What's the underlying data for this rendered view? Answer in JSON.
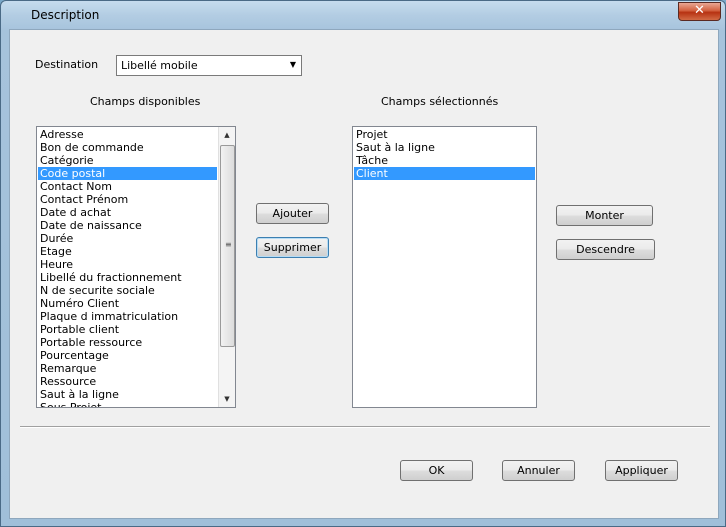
{
  "window": {
    "title": "Description",
    "close_glyph": "✕"
  },
  "destination": {
    "label": "Destination",
    "value": "Libellé mobile"
  },
  "available": {
    "header": "Champs disponibles",
    "items": [
      {
        "label": "Adresse",
        "selected": false
      },
      {
        "label": "Bon de commande",
        "selected": false
      },
      {
        "label": "Catégorie",
        "selected": false
      },
      {
        "label": "Code postal",
        "selected": true
      },
      {
        "label": "Contact Nom",
        "selected": false
      },
      {
        "label": "Contact Prénom",
        "selected": false
      },
      {
        "label": "Date d achat",
        "selected": false
      },
      {
        "label": "Date de naissance",
        "selected": false
      },
      {
        "label": "Durée",
        "selected": false
      },
      {
        "label": "Etage",
        "selected": false
      },
      {
        "label": "Heure",
        "selected": false
      },
      {
        "label": "Libellé du fractionnement",
        "selected": false
      },
      {
        "label": "N de securite sociale",
        "selected": false
      },
      {
        "label": "Numéro Client",
        "selected": false
      },
      {
        "label": "Plaque d immatriculation",
        "selected": false
      },
      {
        "label": "Portable client",
        "selected": false
      },
      {
        "label": "Portable ressource",
        "selected": false
      },
      {
        "label": "Pourcentage",
        "selected": false
      },
      {
        "label": "Remarque",
        "selected": false
      },
      {
        "label": "Ressource",
        "selected": false
      },
      {
        "label": "Saut à la ligne",
        "selected": false
      },
      {
        "label": "Sous Projet",
        "selected": false
      }
    ]
  },
  "selected": {
    "header": "Champs sélectionnés",
    "items": [
      {
        "label": "Projet",
        "selected": false
      },
      {
        "label": "Saut à la ligne",
        "selected": false
      },
      {
        "label": "Tâche",
        "selected": false
      },
      {
        "label": "Client",
        "selected": true
      }
    ]
  },
  "buttons": {
    "add": "Ajouter",
    "remove": "Supprimer",
    "up": "Monter",
    "down": "Descendre",
    "ok": "OK",
    "cancel": "Annuler",
    "apply": "Appliquer"
  }
}
